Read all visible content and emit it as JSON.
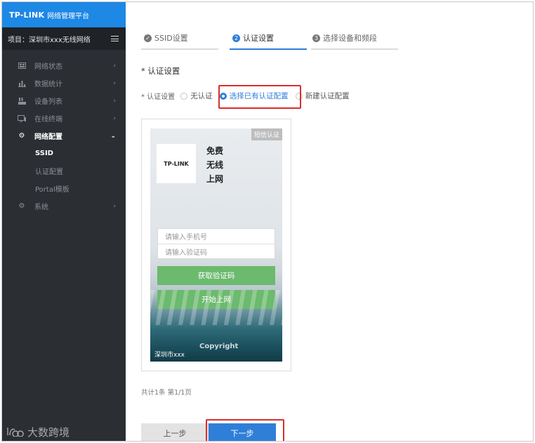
{
  "brand": {
    "logo": "TP-LINK",
    "subtitle": "网络管理平台"
  },
  "project": {
    "label": "项目：深圳市xxx无线网络"
  },
  "sidebar": {
    "items": [
      {
        "label": "网络状态",
        "icon": "dashboard-icon"
      },
      {
        "label": "数据统计",
        "icon": "bar-chart-icon"
      },
      {
        "label": "设备列表",
        "icon": "device-list-icon"
      },
      {
        "label": "在线终端",
        "icon": "monitor-icon"
      },
      {
        "label": "网络配置",
        "icon": "gear-icon"
      },
      {
        "label": "系统",
        "icon": "gear-icon"
      }
    ],
    "subitems": [
      {
        "label": "SSID"
      },
      {
        "label": "认证配置"
      },
      {
        "label": "Portal模板"
      }
    ]
  },
  "steps": [
    {
      "num": "✓",
      "label": "SSID设置"
    },
    {
      "num": "2",
      "label": "认证设置"
    },
    {
      "num": "3",
      "label": "选择设备和频段"
    }
  ],
  "section_title": "* 认证设置",
  "auth": {
    "label": "* 认证设置",
    "options": [
      {
        "label": "无认证"
      },
      {
        "label": "选择已有认证配置"
      },
      {
        "label": "新建认证配置"
      }
    ]
  },
  "preview": {
    "tag": "短信认证",
    "logo_text": "TP-LINK",
    "slogan": "免费 无线 上网",
    "phone_placeholder": "请输入手机号",
    "code_placeholder": "请输入验证码",
    "get_code_label": "获取验证码",
    "start_label": "开始上网",
    "copyright": "Copyright",
    "city": "深圳市xxx"
  },
  "pager": {
    "text": "共计1条   第1/1页"
  },
  "actions": {
    "prev": "上一步",
    "next": "下一步"
  },
  "watermark": {
    "text": "大数跨境"
  },
  "colors": {
    "brand_blue": "#1e88e5",
    "accent_blue": "#2f7fd8",
    "sidebar_bg": "#2b2e33",
    "green": "#6bba6e",
    "highlight_red": "#d82e2e"
  }
}
